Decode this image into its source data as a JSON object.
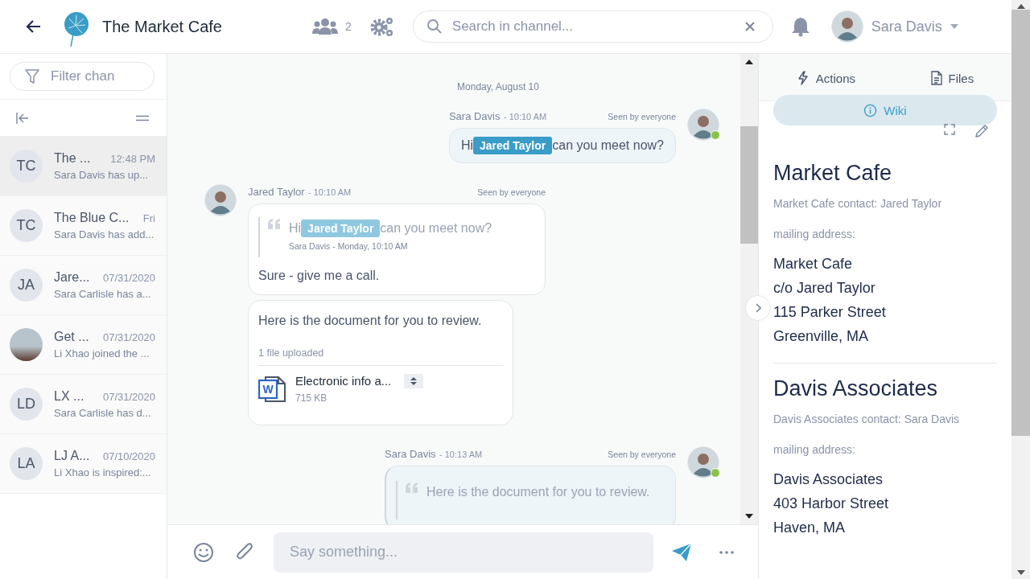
{
  "header": {
    "title": "The Market Cafe",
    "member_count": "2",
    "search": {
      "placeholder": "Search in channel..."
    },
    "user_name": "Sara Davis"
  },
  "sidebar": {
    "filter": {
      "placeholder": "Filter chan"
    },
    "channels": [
      {
        "initials": "TC",
        "name": "The ...",
        "time": "12:48 PM",
        "preview": "Sara Davis has up...",
        "selected": true
      },
      {
        "initials": "TC",
        "name": "The Blue C...",
        "time": "Fri",
        "preview": "Sara Davis has add...",
        "selected": false
      },
      {
        "initials": "JA",
        "name": "Jare...",
        "time": "07/31/2020",
        "preview": "Sara Carlisle has a...",
        "selected": false
      },
      {
        "name": "Get ...",
        "time": "07/31/2020",
        "preview": "Li Xhao joined the ...",
        "selected": false
      },
      {
        "initials": "LD",
        "name": "LX ...",
        "time": "07/31/2020",
        "preview": "Sara Carlisle has d...",
        "selected": false
      },
      {
        "initials": "LA",
        "name": "LJ A...",
        "time": "07/10/2020",
        "preview": "Li Xhao is inspired:...",
        "selected": false
      }
    ]
  },
  "chat": {
    "date": "Monday, August 10",
    "messages": [
      {
        "mine": true,
        "author": "Sara Davis",
        "time": "- 10:10 AM",
        "seen": "Seen by everyone",
        "online": true,
        "bubbles": [
          {
            "kind": "text",
            "before": "Hi",
            "mention": "Jared Taylor",
            "after": "can you meet now?"
          }
        ]
      },
      {
        "mine": false,
        "author": "Jared Taylor",
        "time": "- 10:10 AM",
        "seen": "Seen by everyone",
        "online": false,
        "bubbles": [
          {
            "kind": "reply",
            "quote": {
              "before": "Hi",
              "mention": "Jared Taylor",
              "after": "can you meet now?",
              "meta": "Sara Davis - Monday, 10:10 AM"
            },
            "text": "Sure - give me a call."
          },
          {
            "kind": "file",
            "text": "Here is the document for you to review.",
            "files_label": "1 file uploaded",
            "file_icon_letter": "W",
            "file_name": "Electronic info a...",
            "file_size": "715 KB"
          }
        ]
      },
      {
        "mine": true,
        "author": "Sara Davis",
        "time": "- 10:13 AM",
        "seen": "Seen by everyone",
        "online": true,
        "bubbles": [
          {
            "kind": "quote",
            "quote": {
              "before": "Here is the document for you to review."
            }
          }
        ]
      }
    ]
  },
  "composer": {
    "placeholder": "Say something..."
  },
  "panel": {
    "tabs": [
      {
        "label": "Actions",
        "selected": false
      },
      {
        "label": "Files",
        "selected": false
      },
      {
        "label": "Wiki",
        "selected": true
      }
    ],
    "sections": [
      {
        "heading": "Market Cafe",
        "contact": "Market Cafe contact: Jared Taylor",
        "address_label": "mailing address:",
        "address_lines": [
          "Market Cafe",
          "c/o Jared Taylor",
          "115 Parker Street",
          "Greenville, MA"
        ]
      },
      {
        "heading": "Davis Associates",
        "contact": "Davis Associates contact: Sara Davis",
        "address_label": "mailing address:",
        "address_lines": [
          "Davis Associates",
          "403 Harbor Street",
          "Haven, MA"
        ]
      }
    ]
  }
}
